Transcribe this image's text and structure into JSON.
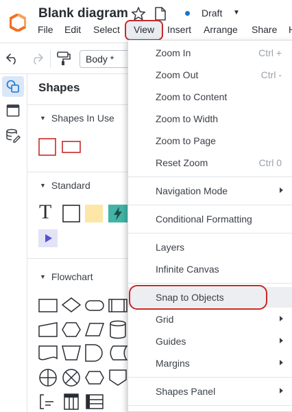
{
  "app": {
    "title": "Blank diagram",
    "status": "Draft",
    "brand_color": "#f26f21",
    "accent_color": "#1a73c9",
    "highlight_outline_color": "#c62828"
  },
  "menubar": {
    "items": [
      {
        "label": "File"
      },
      {
        "label": "Edit"
      },
      {
        "label": "Select"
      },
      {
        "label": "View"
      },
      {
        "label": "Insert"
      },
      {
        "label": "Arrange"
      },
      {
        "label": "Share"
      },
      {
        "label": "H"
      }
    ],
    "active": "View"
  },
  "toolbar": {
    "style_select_value": "Body *",
    "icons": [
      "undo-icon",
      "redo-icon",
      "format-painter-icon"
    ]
  },
  "rail": {
    "icons": [
      "shapes-icon",
      "page-layout-icon",
      "data-linking-icon"
    ]
  },
  "shapes_panel": {
    "title": "Shapes",
    "sections": [
      {
        "label": "Shapes In Use"
      },
      {
        "label": "Standard"
      },
      {
        "label": "Flowchart"
      }
    ],
    "text_shape_glyph": "T"
  },
  "view_menu": {
    "items": [
      {
        "label": "Zoom In",
        "shortcut": "Ctrl +"
      },
      {
        "label": "Zoom Out",
        "shortcut": "Ctrl -"
      },
      {
        "label": "Zoom to Content",
        "shortcut": ""
      },
      {
        "label": "Zoom to Width",
        "shortcut": ""
      },
      {
        "label": "Zoom to Page",
        "shortcut": ""
      },
      {
        "label": "Reset Zoom",
        "shortcut": "Ctrl 0"
      },
      {
        "label": "Navigation Mode",
        "submenu": true
      },
      {
        "label": "Conditional Formatting"
      },
      {
        "label": "Layers"
      },
      {
        "label": "Infinite Canvas"
      },
      {
        "label": "Snap to Objects",
        "highlighted": true
      },
      {
        "label": "Grid",
        "submenu": true
      },
      {
        "label": "Guides",
        "submenu": true
      },
      {
        "label": "Margins",
        "submenu": true
      },
      {
        "label": "Shapes Panel",
        "submenu": true
      }
    ]
  }
}
